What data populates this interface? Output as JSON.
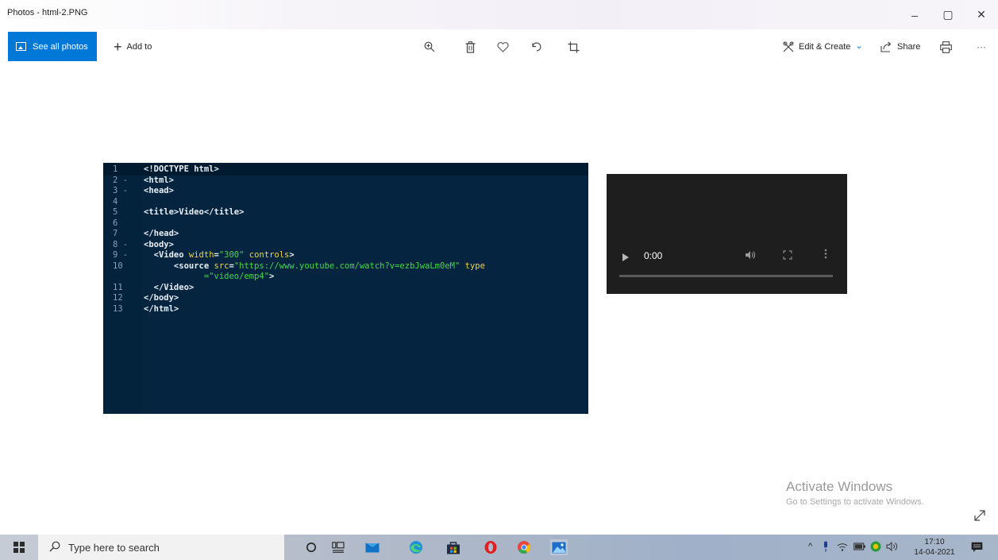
{
  "window": {
    "title": "Photos - html-2.PNG",
    "minimize_glyph": "–",
    "maximize_glyph": "▢",
    "close_glyph": "✕"
  },
  "toolbar": {
    "see_all_photos": "See all photos",
    "add_to": "Add to",
    "add_glyph": "+",
    "edit_create": "Edit & Create",
    "edit_chevron": "⌄",
    "share": "Share",
    "more_glyph": "···",
    "icons": [
      "zoom-in-icon",
      "delete-icon",
      "favorite-icon",
      "rotate-icon",
      "crop-icon",
      "edit-icon",
      "share-icon",
      "print-icon"
    ],
    "accent": "#0078d7"
  },
  "code": {
    "lines": [
      {
        "n": "1",
        "fold": "",
        "parts": [
          [
            "tag",
            "<!DOCTYPE html>"
          ]
        ]
      },
      {
        "n": "2",
        "fold": "-",
        "parts": [
          [
            "tag",
            "<html>"
          ]
        ]
      },
      {
        "n": "3",
        "fold": "-",
        "parts": [
          [
            "tag",
            "<head>"
          ]
        ]
      },
      {
        "n": "4",
        "fold": "",
        "parts": []
      },
      {
        "n": "5",
        "fold": "",
        "parts": [
          [
            "tag",
            "<title>Video</title>"
          ]
        ]
      },
      {
        "n": "6",
        "fold": "",
        "parts": []
      },
      {
        "n": "7",
        "fold": "",
        "parts": [
          [
            "tag",
            "</head>"
          ]
        ]
      },
      {
        "n": "8",
        "fold": "-",
        "parts": [
          [
            "tag",
            "<body>"
          ]
        ]
      },
      {
        "n": "9",
        "fold": "-",
        "parts": [
          [
            "tag",
            "  <Video "
          ],
          [
            "attr",
            "width"
          ],
          [
            "tag",
            "="
          ],
          [
            "str",
            "\"300\""
          ],
          [
            "tag",
            " "
          ],
          [
            "attr",
            "controls"
          ],
          [
            "tag",
            ">"
          ]
        ]
      },
      {
        "n": "10",
        "fold": "",
        "parts": [
          [
            "tag",
            "      <source "
          ],
          [
            "attr",
            "src"
          ],
          [
            "tag",
            "="
          ],
          [
            "str",
            "\"https://www.youtube.com/watch?v=ezbJwaLm0eM\""
          ],
          [
            "tag",
            " "
          ],
          [
            "attr",
            "type"
          ]
        ]
      },
      {
        "n": "",
        "fold": "",
        "parts": [
          [
            "tag",
            "            "
          ],
          [
            "str",
            "=\"video/emp4\""
          ],
          [
            "tag",
            ">"
          ]
        ]
      },
      {
        "n": "11",
        "fold": "",
        "parts": [
          [
            "tag",
            "  </Video>"
          ]
        ]
      },
      {
        "n": "12",
        "fold": "",
        "parts": [
          [
            "tag",
            "</body>"
          ]
        ]
      },
      {
        "n": "13",
        "fold": "",
        "parts": [
          [
            "tag",
            "</html>"
          ]
        ]
      }
    ],
    "colors": {
      "background": "#04243f",
      "tag": "#e8eef4",
      "attr": "#f0d44a",
      "string": "#48d848",
      "line_number": "#8aa0b4"
    }
  },
  "video": {
    "time": "0:00",
    "progress": 0
  },
  "watermark": {
    "heading": "Activate Windows",
    "subtext": "Go to Settings to activate Windows."
  },
  "taskbar": {
    "search_placeholder": "Type here to search",
    "apps": [
      "cortana-icon",
      "task-view-icon",
      "mail-icon",
      "edge-icon",
      "store-icon",
      "opera-icon",
      "chrome-icon",
      "photos-icon"
    ],
    "tray_chevron": "^",
    "time": "17:10",
    "date": "14-04-2021"
  }
}
